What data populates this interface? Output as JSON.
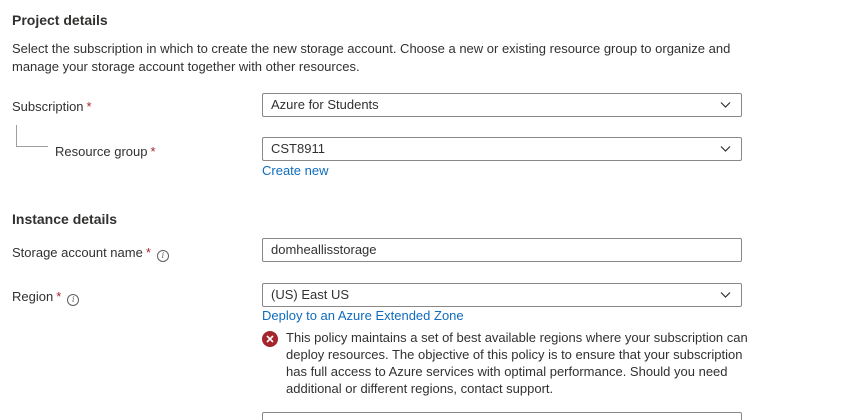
{
  "project": {
    "heading": "Project details",
    "description": "Select the subscription in which to create the new storage account. Choose a new or existing resource group to organize and manage your storage account together with other resources.",
    "subscription": {
      "label": "Subscription",
      "required": "*",
      "value": "Azure for Students"
    },
    "resource_group": {
      "label": "Resource group",
      "required": "*",
      "value": "CST8911",
      "create_new_link": "Create new"
    }
  },
  "instance": {
    "heading": "Instance details",
    "storage_account_name": {
      "label": "Storage account name",
      "required": "*",
      "value": "domheallisstorage"
    },
    "region": {
      "label": "Region",
      "required": "*",
      "value": "(US) East US",
      "extended_zone_link": "Deploy to an Azure Extended Zone",
      "error_message": "This policy maintains a set of best available regions where your subscription can deploy resources. The objective of this policy is to ensure that your subscription has full access to Azure services with optimal performance. Should you need additional or different regions, contact support."
    }
  },
  "icons": {
    "info": "info-icon",
    "chevron": "chevron-down-icon",
    "error": "error-icon"
  },
  "colors": {
    "link": "#0f6cbd",
    "required": "#a4262c",
    "error": "#a4262c",
    "border": "#8a8886"
  }
}
